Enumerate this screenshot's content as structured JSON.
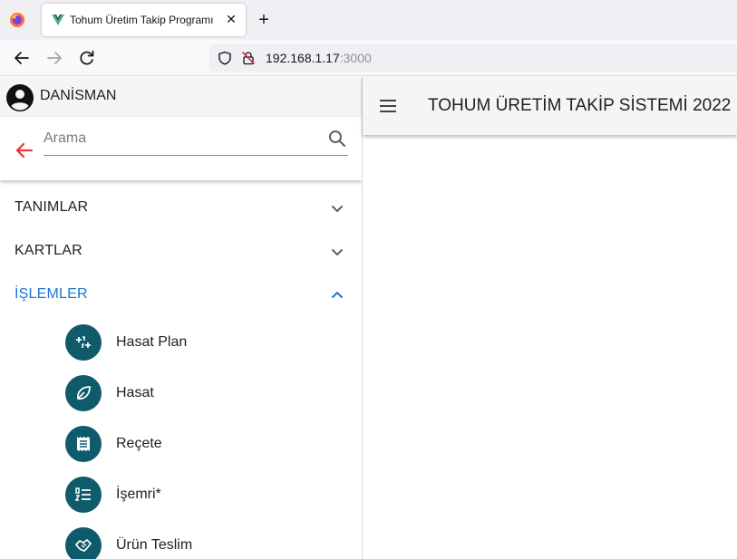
{
  "browser": {
    "tab_title": "Tohum Üretim Takip Programı",
    "tab_close": "✕",
    "new_tab": "+",
    "url_host": "192.168.1.17",
    "url_port": ":3000"
  },
  "sidebar": {
    "user_name": "DANİSMAN",
    "search_placeholder": "Arama",
    "menu": [
      {
        "label": "TANIMLAR",
        "expanded": false
      },
      {
        "label": "KARTLAR",
        "expanded": false
      },
      {
        "label": "İŞLEMLER",
        "expanded": true
      }
    ],
    "sub_items": [
      {
        "label": "Hasat Plan",
        "icon": "transfer-icon"
      },
      {
        "label": "Hasat",
        "icon": "leaf-icon"
      },
      {
        "label": "Reçete",
        "icon": "receipt-icon"
      },
      {
        "label": "İşemri*",
        "icon": "ordered-list-icon"
      },
      {
        "label": "Ürün Teslim",
        "icon": "handshake-icon"
      }
    ]
  },
  "header": {
    "title": "TOHUM ÜRETİM TAKİP SİSTEMİ 2022"
  },
  "colors": {
    "active_menu": "#1976d2",
    "icon_avatar": "#0f5a6b",
    "back_arrow": "#e53935"
  }
}
